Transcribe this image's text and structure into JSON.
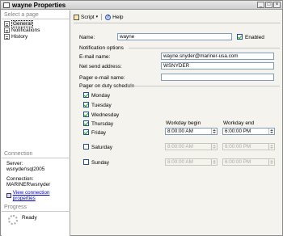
{
  "window": {
    "title": "wayne Properties"
  },
  "left": {
    "select_page": "Select a page",
    "pages": [
      "General",
      "Notifications",
      "History"
    ],
    "connection_header": "Connection",
    "server_label": "Server:",
    "server_value": "wsnyder\\sql2005",
    "connection_label": "Connection:",
    "connection_value": "MARINER\\wsnyder",
    "view_link": "View connection properties",
    "progress_header": "Progress",
    "status": "Ready"
  },
  "toolbar": {
    "script": "Script",
    "help": "Help"
  },
  "form": {
    "name_label": "Name:",
    "name_value": "wayne",
    "enabled_label": "Enabled",
    "notification_options": "Notification options",
    "email_label": "E-mail name:",
    "email_value": "wayne.snyder@mariner-usa.com",
    "netsend_label": "Net send address:",
    "netsend_value": "WSNYDER",
    "pager_label": "Pager e-mail name:",
    "pager_value": "",
    "schedule_title": "Pager on duty schedule",
    "days": [
      "Monday",
      "Tuesday",
      "Wednesday",
      "Thursday",
      "Friday"
    ],
    "workday_begin": "Workday begin",
    "workday_end": "Workday end",
    "weekday_begin": "8:00:00 AM",
    "weekday_end": "6:00:00 PM",
    "saturday": "Saturday",
    "sat_begin": "8:00:00 AM",
    "sat_end": "6:00:00 PM",
    "sunday": "Sunday",
    "sun_begin": "8:00:00 AM",
    "sun_end": "6:00:00 PM"
  }
}
